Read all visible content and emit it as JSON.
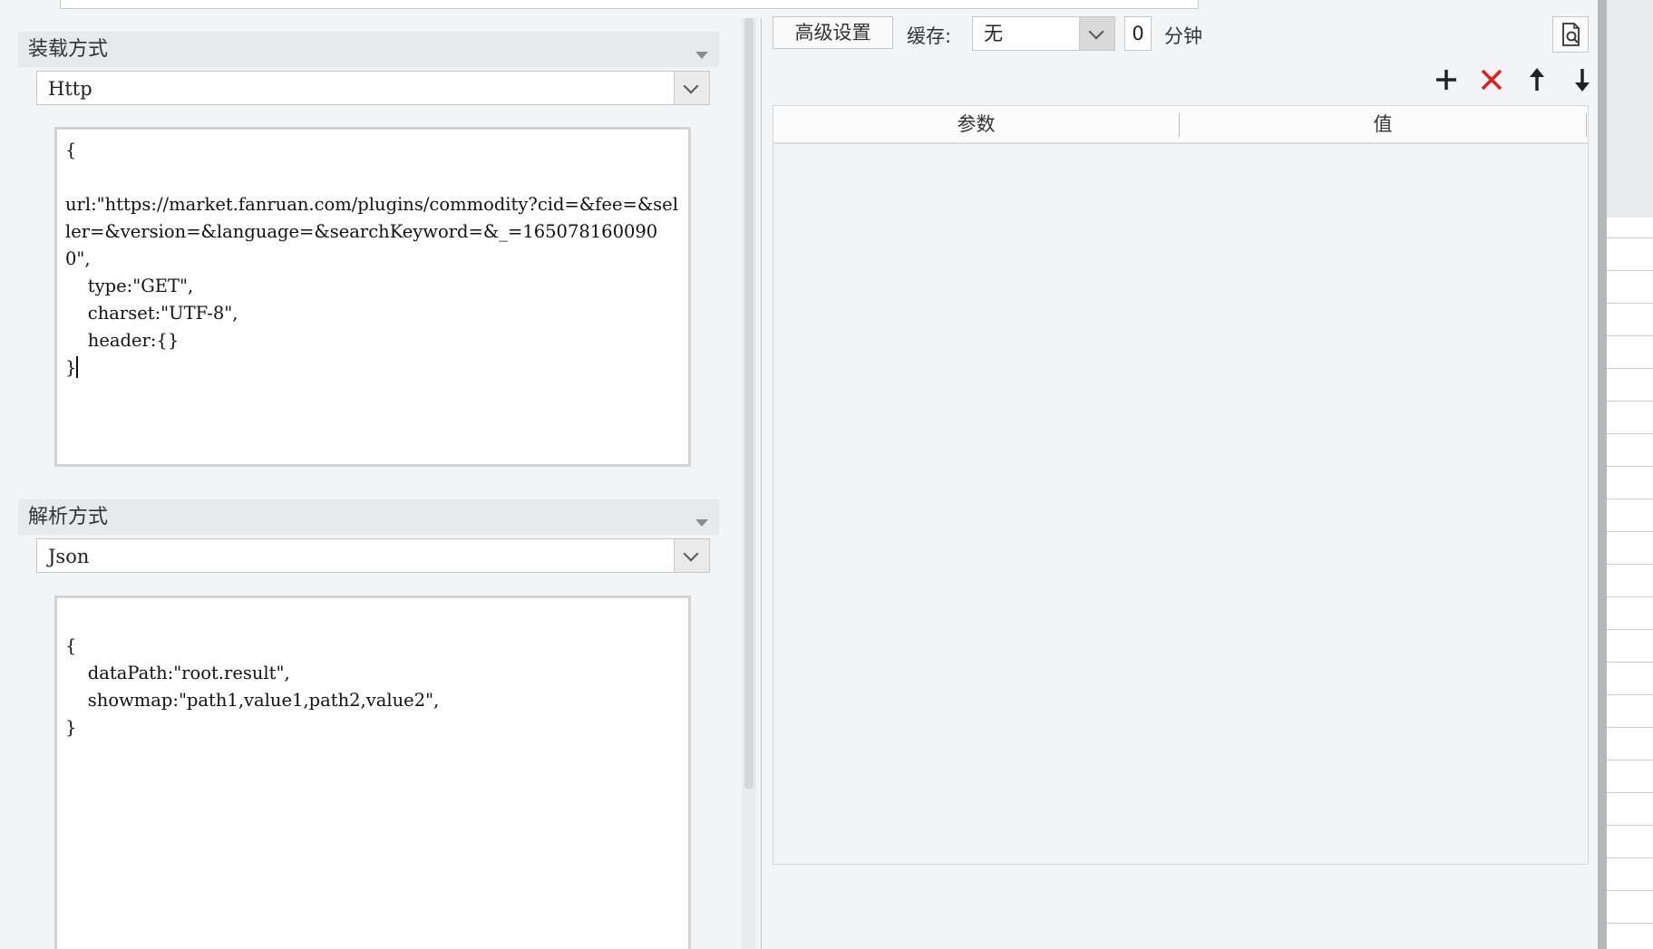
{
  "top": {
    "label": "…"
  },
  "load_section": {
    "title": "装载方式",
    "mode_value": "Http",
    "code": "{\n\nurl:\"https://market.fanruan.com/plugins/commodity?cid=&fee=&seller=&version=&language=&searchKeyword=&_=1650781600900\",\n    type:\"GET\",\n    charset:\"UTF-8\",\n    header:{}\n}"
  },
  "parse_section": {
    "title": "解析方式",
    "mode_value": "Json",
    "code": "\n{\n    dataPath:\"root.result\",\n    showmap:\"path1,value1,path2,value2\",\n}"
  },
  "toolbar": {
    "advanced_label": "高级设置",
    "cache_label": "缓存:",
    "cache_value": "无",
    "cache_minutes": "0",
    "minutes_unit": "分钟"
  },
  "param_table": {
    "columns": [
      "参数",
      "值"
    ]
  },
  "colors": {
    "add_icon": "#222222",
    "delete_icon": "#e02020",
    "move_icon": "#222222"
  },
  "icons": {
    "add": "plus-icon",
    "delete": "close-icon",
    "up": "arrow-up-icon",
    "down": "arrow-down-icon",
    "preview": "preview-icon"
  }
}
